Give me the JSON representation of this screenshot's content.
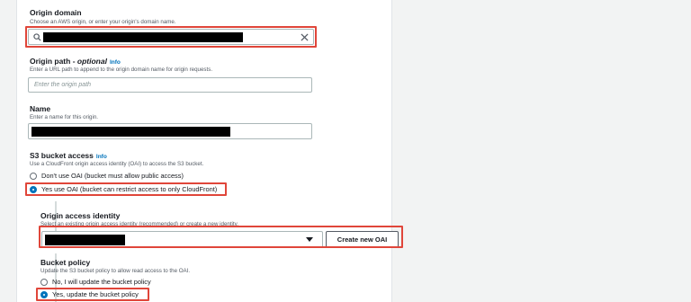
{
  "origin_domain": {
    "label": "Origin domain",
    "description": "Choose an AWS origin, or enter your origin's domain name.",
    "value_redacted": true
  },
  "origin_path": {
    "label_main": "Origin path - ",
    "label_optional": "optional",
    "info": "Info",
    "description": "Enter a URL path to append to the origin domain name for origin requests.",
    "placeholder": "Enter the origin path"
  },
  "name": {
    "label": "Name",
    "description": "Enter a name for this origin.",
    "value_redacted": true
  },
  "s3_bucket_access": {
    "label": "S3 bucket access",
    "info": "Info",
    "description": "Use a CloudFront origin access identity (OAI) to access the S3 bucket.",
    "options": [
      {
        "label": "Don't use OAI (bucket must allow public access)",
        "selected": false
      },
      {
        "label": "Yes use OAI (bucket can restrict access to only CloudFront)",
        "selected": true
      }
    ]
  },
  "origin_access_identity": {
    "label": "Origin access identity",
    "description": "Select an existing origin access identity (recommended) or create a new identity.",
    "value_redacted": true,
    "create_button": "Create new OAI"
  },
  "bucket_policy": {
    "label": "Bucket policy",
    "description": "Update the S3 bucket policy to allow read access to the OAI.",
    "options": [
      {
        "label": "No, I will update the bucket policy",
        "selected": false
      },
      {
        "label": "Yes, update the bucket policy",
        "selected": true
      }
    ]
  },
  "colors": {
    "accent": "#0073bb",
    "highlight": "#e0463a",
    "panel": "#ffffff",
    "background": "#f2f3f3"
  }
}
